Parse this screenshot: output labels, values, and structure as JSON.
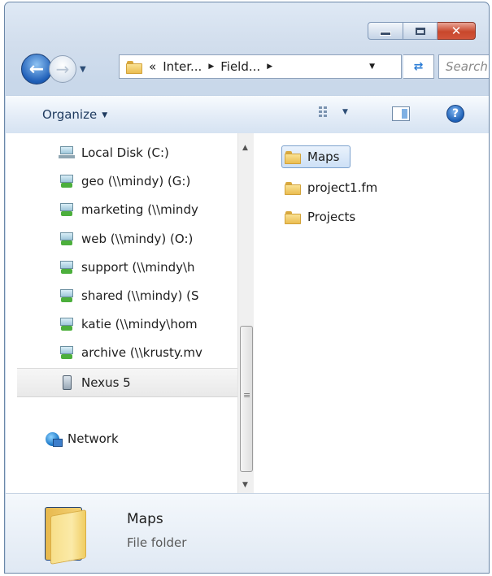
{
  "window": {
    "minimize_label": "Minimize",
    "maximize_label": "Maximize",
    "close_glyph": "✕"
  },
  "address_bar": {
    "overflow": "«",
    "segments": [
      "Inter...",
      "Field..."
    ],
    "search_placeholder": "Search"
  },
  "toolbar": {
    "organize_label": "Organize",
    "views_icon": "views-icon",
    "preview_pane_icon": "preview-pane-icon",
    "help_glyph": "?"
  },
  "nav_pane": {
    "items": [
      {
        "label": "Local Disk (C:)",
        "icon": "local-disk-icon"
      },
      {
        "label": "geo (\\\\mindy) (G:)",
        "icon": "network-drive-icon"
      },
      {
        "label": "marketing (\\\\mindy",
        "icon": "network-drive-icon"
      },
      {
        "label": "web (\\\\mindy) (O:)",
        "icon": "network-drive-icon"
      },
      {
        "label": "support (\\\\mindy\\h",
        "icon": "network-drive-icon"
      },
      {
        "label": "shared (\\\\mindy) (S",
        "icon": "network-drive-icon"
      },
      {
        "label": "katie (\\\\mindy\\hom",
        "icon": "network-drive-icon"
      },
      {
        "label": "archive (\\\\krusty.mv",
        "icon": "network-drive-icon"
      },
      {
        "label": "Nexus 5",
        "icon": "phone-icon"
      }
    ],
    "network_label": "Network"
  },
  "files": [
    {
      "label": "Maps",
      "selected": true
    },
    {
      "label": "project1.fm",
      "selected": false
    },
    {
      "label": "Projects",
      "selected": false
    }
  ],
  "details": {
    "name": "Maps",
    "type": "File folder"
  },
  "colors": {
    "selection": "#cde0f6",
    "frame": "#c9d8ea"
  }
}
